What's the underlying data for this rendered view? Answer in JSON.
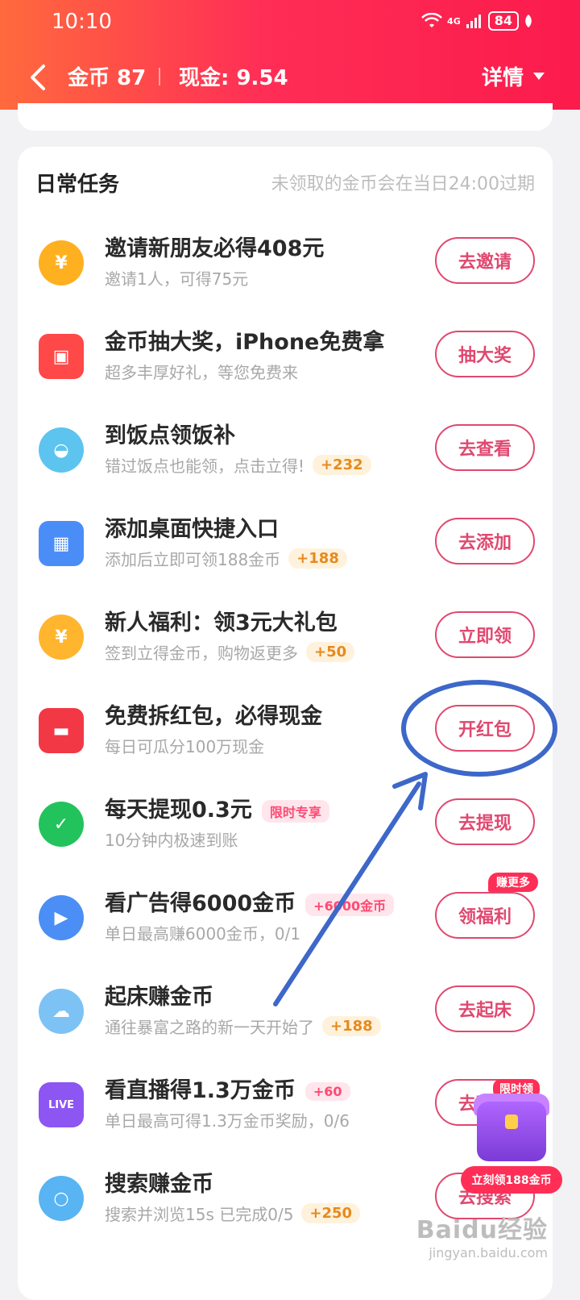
{
  "status": {
    "time": "10:10",
    "network": "4G",
    "battery": "84"
  },
  "header": {
    "coins": "金币 87",
    "cash": "现金: 9.54",
    "detail": "详情"
  },
  "section": {
    "title": "日常任务",
    "note": "未领取的金币会在当日24:00过期"
  },
  "tasks": [
    {
      "title": "邀请新朋友必得408元",
      "sub": "邀请1人，可得75元",
      "badge": "",
      "tag": "",
      "button": "去邀请",
      "corner": "",
      "icon": "coin-icon",
      "color": "#ffb020"
    },
    {
      "title": "金币抽大奖，iPhone免费拿",
      "sub": "超多丰厚好礼，等您免费来",
      "badge": "",
      "tag": "",
      "button": "抽大奖",
      "corner": "",
      "icon": "gift-box-icon",
      "color": "#ff4848"
    },
    {
      "title": "到饭点领饭补",
      "sub": "错过饭点也能领，点击立得!",
      "badge": "+232",
      "tag": "",
      "button": "去查看",
      "corner": "",
      "icon": "rice-bowl-icon",
      "color": "#5cc4ef"
    },
    {
      "title": "添加桌面快捷入口",
      "sub": "添加后立即可领188金币",
      "badge": "+188",
      "tag": "",
      "button": "去添加",
      "corner": "",
      "icon": "app-grid-icon",
      "color": "#4a8df7"
    },
    {
      "title": "新人福利：领3元大礼包",
      "sub": "签到立得金币，购物返更多",
      "badge": "+50",
      "tag": "",
      "button": "立即领",
      "corner": "",
      "icon": "money-bag-icon",
      "color": "#ffb52e"
    },
    {
      "title": "免费拆红包，必得现金",
      "sub": "每日可瓜分100万现金",
      "badge": "",
      "tag": "",
      "button": "开红包",
      "corner": "",
      "icon": "red-envelope-icon",
      "color": "#f23845"
    },
    {
      "title": "每天提现0.3元",
      "sub": "10分钟内极速到账",
      "badge": "",
      "tag": "限时专享",
      "button": "去提现",
      "corner": "",
      "icon": "check-circle-icon",
      "color": "#22c35c"
    },
    {
      "title": "看广告得6000金币",
      "sub": "单日最高赚6000金币，0/1",
      "badge": "",
      "tag": "+6000金币",
      "button": "领福利",
      "corner": "赚更多",
      "icon": "play-video-icon",
      "color": "#4b8ef5"
    },
    {
      "title": "起床赚金币",
      "sub": "通往暴富之路的新一天开始了",
      "badge": "+188",
      "tag": "",
      "button": "去起床",
      "corner": "",
      "icon": "weather-cloud-icon",
      "color": "#7cc2f5"
    },
    {
      "title": "看直播得1.3万金币",
      "sub": "单日最高可得1.3万金币奖励，0/6",
      "badge": "",
      "tag": "+60",
      "button": "去观看",
      "corner": "",
      "icon": "live-tv-icon",
      "color": "#8d55f2"
    },
    {
      "title": "搜索赚金币",
      "sub": "搜索并浏览15s 已完成0/5",
      "badge": "+250",
      "tag": "",
      "button": "去搜索",
      "corner": "",
      "icon": "search-icon",
      "color": "#58b4f2"
    }
  ],
  "floating_chest": {
    "top_tag": "限时领",
    "bottom_tag": "立刻领188金币"
  },
  "watermark": {
    "main": "Baidu经验",
    "sub": "jingyan.baidu.com"
  }
}
